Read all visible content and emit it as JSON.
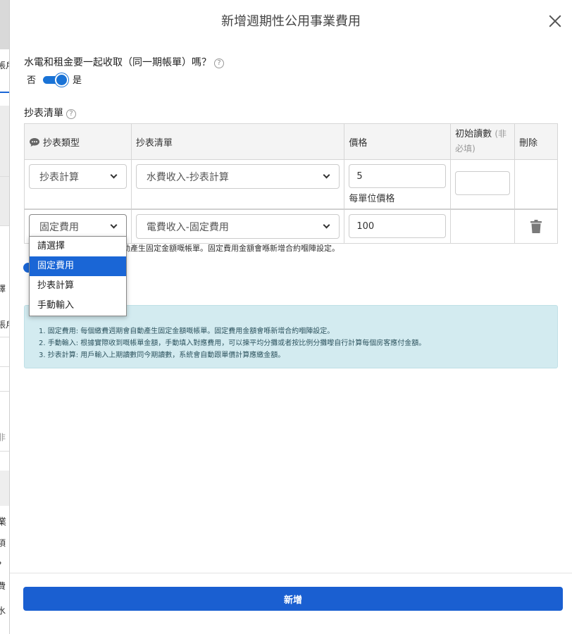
{
  "background_fragments": [
    "帳戶",
    "擇",
    "張戶",
    "非",
    "業",
    "項",
    "?",
    "費",
    "水"
  ],
  "modal": {
    "title": "新增週期性公用事業費用",
    "question_label": "水電和租金要一起收取（同一期帳單）嗎？",
    "toggle": {
      "off_label": "否",
      "on_label": "是",
      "checked": true
    },
    "section_label": "抄表清單",
    "table": {
      "headers": {
        "type": "抄表類型",
        "list": "抄表清單",
        "price": "價格",
        "initial": "初始讀數",
        "initial_optional": "(非必填)",
        "delete": "刪除"
      },
      "rows": [
        {
          "type": "抄表計算",
          "list": "水費收入-抄表計算",
          "price": "5",
          "price_sub": "每單位價格",
          "initial": ""
        },
        {
          "type": "固定費用",
          "list": "電費收入-固定費用",
          "price": "100"
        }
      ]
    },
    "hint_text": "自動產生固定金額嘅帳單。固定費用金額會喺新增合約嗰陣設定。",
    "dropdown_options": [
      {
        "label": "請選擇",
        "active": false
      },
      {
        "label": "固定費用",
        "active": true
      },
      {
        "label": "抄表計算",
        "active": false
      },
      {
        "label": "手動輸入",
        "active": false
      }
    ],
    "info_lines": [
      "1. 固定費用: 每個繳費週期會自動產生固定金額嘅帳單。固定費用金額會喺新增合約嗰陣設定。",
      "2. 手動輸入: 根據實際收到嘅帳單金額，手動填入對應費用，可以揀平均分攤或者按比例分攤嚟自行計算每個房客應付金額。",
      "3. 抄表計算: 用戶輸入上期讀數同今期讀數，系統會自動跟單價計算應繳金額。"
    ],
    "submit_label": "新增"
  },
  "colors": {
    "primary": "#1a5fd1",
    "info_bg": "#d3ebf0",
    "header_bg": "#f4f4f4"
  }
}
